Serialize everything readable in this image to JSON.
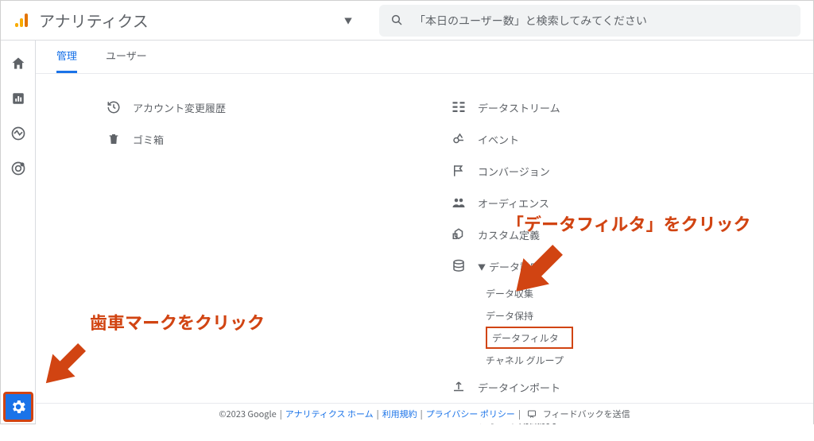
{
  "app_title": "アナリティクス",
  "search": {
    "placeholder": "「本日のユーザー数」と検索してみてください"
  },
  "tabs": {
    "admin": "管理",
    "user": "ユーザー"
  },
  "left_column": {
    "history": "アカウント変更履歴",
    "trash": "ゴミ箱"
  },
  "right_column": {
    "data_stream": "データストリーム",
    "event": "イベント",
    "conversion": "コンバージョン",
    "audience": "オーディエンス",
    "custom_def": "カスタム定義",
    "data_settings": "データ設定",
    "sub": {
      "collect": "データ収集",
      "retain": "データ保持",
      "filter": "データフィルタ",
      "channel_group": "チャネル グループ"
    },
    "data_import": "データインポート",
    "report_id": "レポート用識別子"
  },
  "annotations": {
    "gear": "歯車マークをクリック",
    "filter": "「データフィルタ」をクリック"
  },
  "footer": {
    "copyright": "©2023 Google",
    "home": "アナリティクス ホーム",
    "terms": "利用規約",
    "privacy": "プライバシー ポリシー",
    "feedback": "フィードバックを送信"
  }
}
